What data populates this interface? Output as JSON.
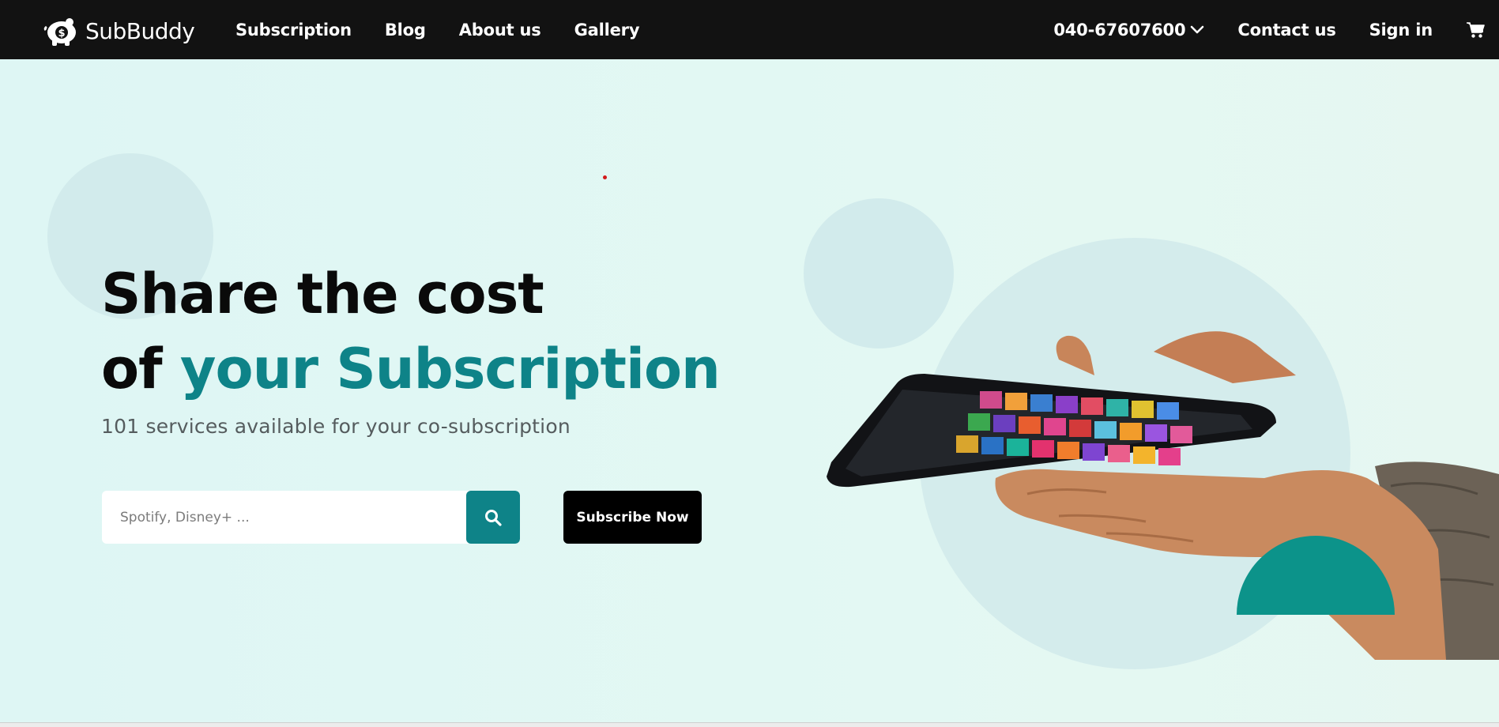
{
  "nav": {
    "brand": "SubBuddy",
    "links": [
      "Subscription",
      "Blog",
      "About us",
      "Gallery"
    ],
    "phone": "040-67607600",
    "contact": "Contact us",
    "signin": "Sign in",
    "icons": {
      "logo": "piggy-bank-dollar-icon",
      "phone_dropdown": "chevron-down-icon",
      "cart": "cart-icon"
    }
  },
  "hero": {
    "headline_line1": "Share the cost",
    "headline_line2_prefix": "of ",
    "headline_line2_accent": "your Subscription",
    "subtitle": "101 services available for your co-subscription",
    "search": {
      "placeholder": "Spotify, Disney+ ...",
      "value": "",
      "button_icon": "search-icon"
    },
    "cta": "Subscribe Now",
    "image": "hand-holding-phone-with-app-icons"
  },
  "colors": {
    "nav_bg": "#121212",
    "hero_bg": "#e2f6f3",
    "accent": "#0e8388",
    "teal_shape": "#0c938a",
    "button_dark": "#000000"
  }
}
